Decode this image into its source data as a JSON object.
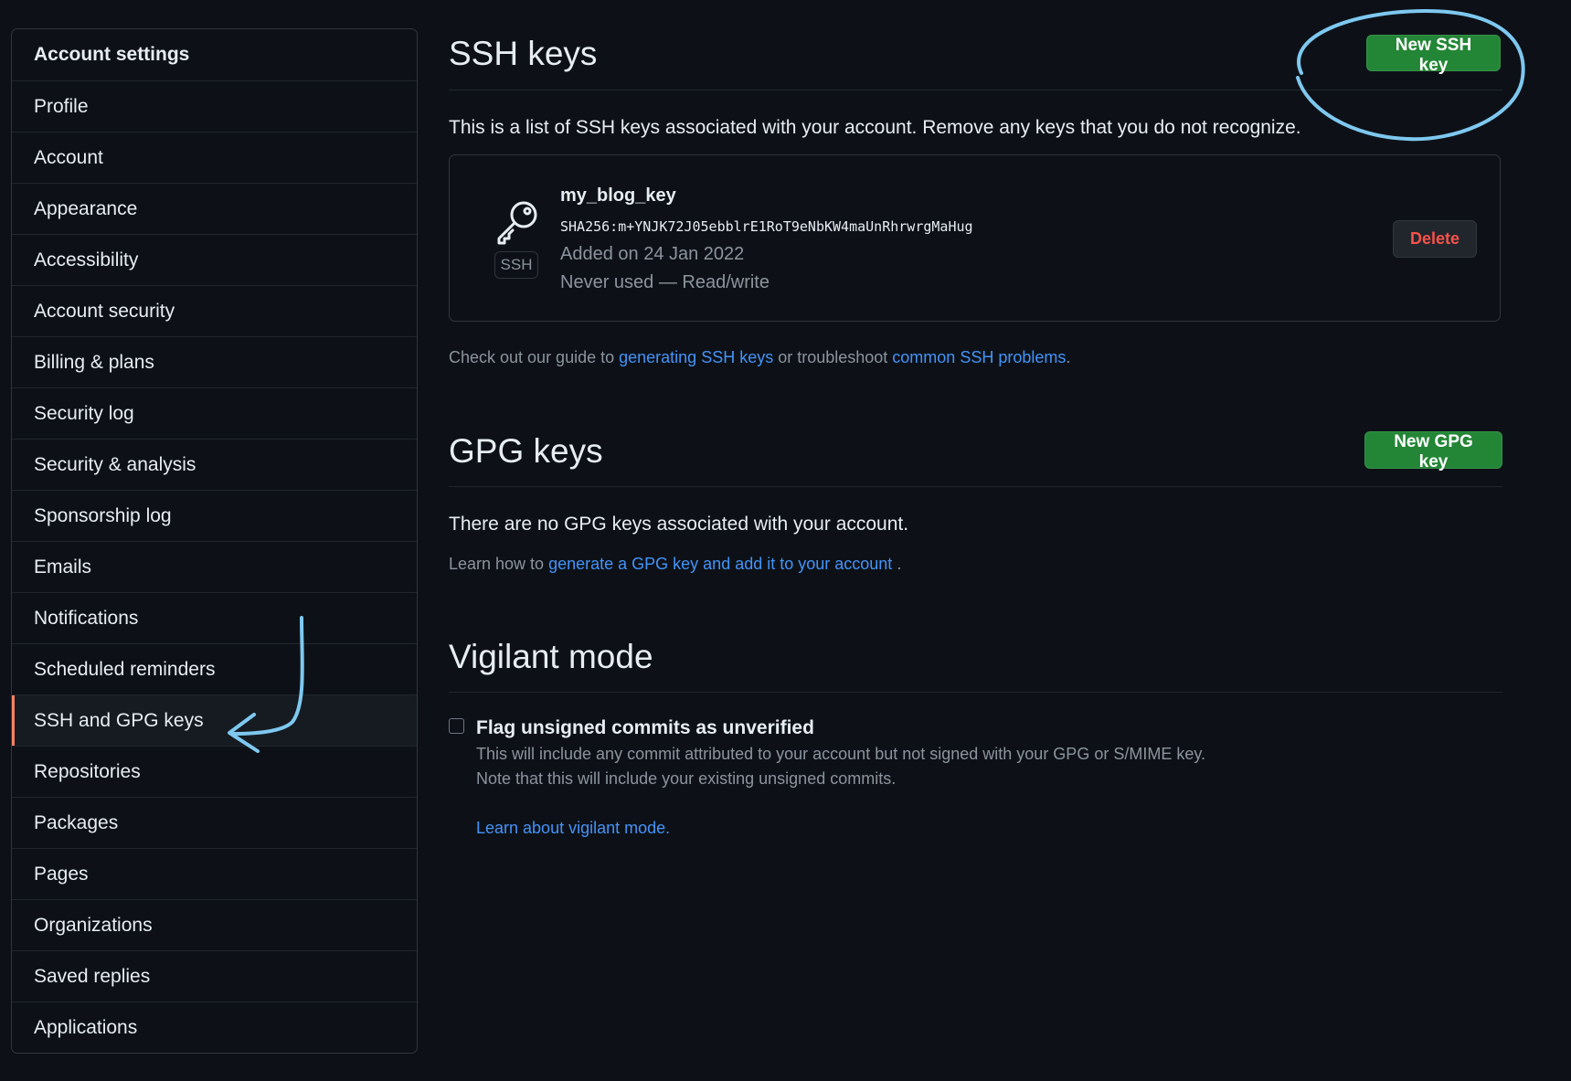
{
  "sidebar": {
    "header": "Account settings",
    "items": [
      {
        "label": "Profile"
      },
      {
        "label": "Account"
      },
      {
        "label": "Appearance"
      },
      {
        "label": "Accessibility"
      },
      {
        "label": "Account security"
      },
      {
        "label": "Billing & plans"
      },
      {
        "label": "Security log"
      },
      {
        "label": "Security & analysis"
      },
      {
        "label": "Sponsorship log"
      },
      {
        "label": "Emails"
      },
      {
        "label": "Notifications"
      },
      {
        "label": "Scheduled reminders"
      },
      {
        "label": "SSH and GPG keys",
        "active": true
      },
      {
        "label": "Repositories"
      },
      {
        "label": "Packages"
      },
      {
        "label": "Pages"
      },
      {
        "label": "Organizations"
      },
      {
        "label": "Saved replies"
      },
      {
        "label": "Applications"
      }
    ]
  },
  "ssh": {
    "title": "SSH keys",
    "new_button": "New SSH key",
    "description": "This is a list of SSH keys associated with your account. Remove any keys that you do not recognize.",
    "key": {
      "badge": "SSH",
      "name": "my_blog_key",
      "fingerprint": "SHA256:m+YNJK72J05ebblrE1RoT9eNbKW4maUnRhrwrgMaHug",
      "added": "Added on 24 Jan 2022",
      "usage": "Never used — Read/write",
      "delete_button": "Delete"
    },
    "guide_prefix": "Check out our guide to ",
    "guide_link1": "generating SSH keys",
    "guide_middle": " or troubleshoot ",
    "guide_link2": "common SSH problems",
    "guide_suffix": "."
  },
  "gpg": {
    "title": "GPG keys",
    "new_button": "New GPG key",
    "empty_text": "There are no GPG keys associated with your account.",
    "learn_prefix": "Learn how to ",
    "learn_link": "generate a GPG key and add it to your account",
    "learn_suffix": " ."
  },
  "vigilant": {
    "title": "Vigilant mode",
    "checkbox_label": "Flag unsigned commits as unverified",
    "checked": false,
    "desc_line1": "This will include any commit attributed to your account but not signed with your GPG or S/MIME key.",
    "desc_line2": "Note that this will include your existing unsigned commits.",
    "learn_link": "Learn about vigilant mode."
  },
  "colors": {
    "background": "#0d1117",
    "accent_green": "#238636",
    "link": "#4493f8",
    "danger": "#f85149",
    "active_marker": "#f78166",
    "annotation": "#7ec8f0"
  }
}
